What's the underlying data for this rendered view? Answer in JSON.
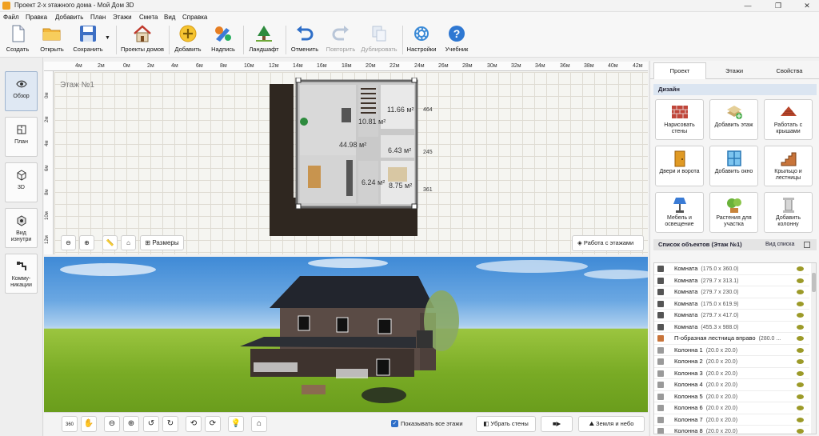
{
  "window": {
    "title": "Проект 2-х этажного дома - Мой Дом 3D",
    "minimize_icon": "minimize-icon",
    "maximize_icon": "maximize-icon",
    "close_icon": "close-icon"
  },
  "menu": [
    "Файл",
    "Правка",
    "Добавить",
    "План",
    "Этажи",
    "Смета",
    "Вид",
    "Справка"
  ],
  "toolbar": {
    "create": "Создать",
    "open": "Открыть",
    "save": "Сохранить",
    "house_projects": "Проекты домов",
    "add": "Добавить",
    "label": "Надпись",
    "landscape": "Ландшафт",
    "undo": "Отменить",
    "redo": "Повторить",
    "duplicate": "Дублировать",
    "settings": "Настройки",
    "tutorial": "Учебник"
  },
  "left_panel": {
    "overview": "Обзор",
    "plan": "План",
    "view3d": "3D",
    "inside_view": "Вид изнутри",
    "communications": "Комму-никации"
  },
  "plan": {
    "floor_label": "Этаж №1",
    "ruler_top": [
      "4м",
      "2м",
      "0м",
      "2м",
      "4м",
      "6м",
      "8м",
      "10м",
      "12м",
      "14м",
      "16м",
      "18м",
      "20м",
      "22м",
      "24м",
      "26м",
      "28м",
      "30м",
      "32м",
      "34м",
      "36м",
      "38м",
      "40м",
      "42м"
    ],
    "ruler_left": [
      "0м",
      "2м",
      "4м",
      "6м",
      "8м",
      "10м",
      "12м"
    ],
    "rooms": {
      "r1": "44.98 м²",
      "r2": "10.81 м²",
      "r3": "11.66 м²",
      "r4": "6.43 м²",
      "r5": "6.24 м²",
      "r6": "8.75 м²"
    },
    "dims": {
      "d1": "464",
      "d2": "245",
      "d3": "361"
    },
    "sizes_button": "Размеры",
    "work_floors_button": "Работа с этажами"
  },
  "bottom": {
    "show_all_floors": "Показывать все этажи",
    "remove_walls": "Убрать стены",
    "ground_sky": "Земля и небо",
    "rotate_label": "360"
  },
  "right_panel": {
    "tabs": [
      "Проект",
      "Этажи",
      "Свойства"
    ],
    "design_header": "Дизайн",
    "design_buttons": [
      {
        "label": "Нарисовать стены",
        "icon": "brick-wall-icon"
      },
      {
        "label": "Добавить этаж",
        "icon": "add-floor-icon"
      },
      {
        "label": "Работать с крышами",
        "icon": "roof-icon"
      },
      {
        "label": "Двери и ворота",
        "icon": "door-icon"
      },
      {
        "label": "Добавить окно",
        "icon": "window-icon"
      },
      {
        "label": "Крыльцо и лестницы",
        "icon": "stairs-icon"
      },
      {
        "label": "Мебель и освещение",
        "icon": "lamp-icon"
      },
      {
        "label": "Растения для участка",
        "icon": "plant-icon"
      },
      {
        "label": "Добавить колонну",
        "icon": "column-icon"
      }
    ],
    "objects_header": "Список объектов (Этаж №1)",
    "view_list": "Вид списка",
    "objects": [
      {
        "name": "Комната",
        "dims": "(175.0 x 360.0)",
        "icon": "room-icon"
      },
      {
        "name": "Комната",
        "dims": "(279.7 x 313.1)",
        "icon": "room-icon"
      },
      {
        "name": "Комната",
        "dims": "(279.7 x 230.0)",
        "icon": "room-icon"
      },
      {
        "name": "Комната",
        "dims": "(175.0 x 619.9)",
        "icon": "room-icon"
      },
      {
        "name": "Комната",
        "dims": "(279.7 x 417.0)",
        "icon": "room-icon"
      },
      {
        "name": "Комната",
        "dims": "(455.3 x 988.0)",
        "icon": "room-icon"
      },
      {
        "name": "П-образная лестница вправо",
        "dims": "(280.0 ...",
        "icon": "stairs-icon"
      },
      {
        "name": "Колонна 1",
        "dims": "(20.0 x 20.0)",
        "icon": "column-icon"
      },
      {
        "name": "Колонна 2",
        "dims": "(20.0 x 20.0)",
        "icon": "column-icon"
      },
      {
        "name": "Колонна 3",
        "dims": "(20.0 x 20.0)",
        "icon": "column-icon"
      },
      {
        "name": "Колонна 4",
        "dims": "(20.0 x 20.0)",
        "icon": "column-icon"
      },
      {
        "name": "Колонна 5",
        "dims": "(20.0 x 20.0)",
        "icon": "column-icon"
      },
      {
        "name": "Колонна 6",
        "dims": "(20.0 x 20.0)",
        "icon": "column-icon"
      },
      {
        "name": "Колонна 7",
        "dims": "(20.0 x 20.0)",
        "icon": "column-icon"
      },
      {
        "name": "Колонна 8",
        "dims": "(20.0 x 20.0)",
        "icon": "column-icon"
      }
    ]
  }
}
